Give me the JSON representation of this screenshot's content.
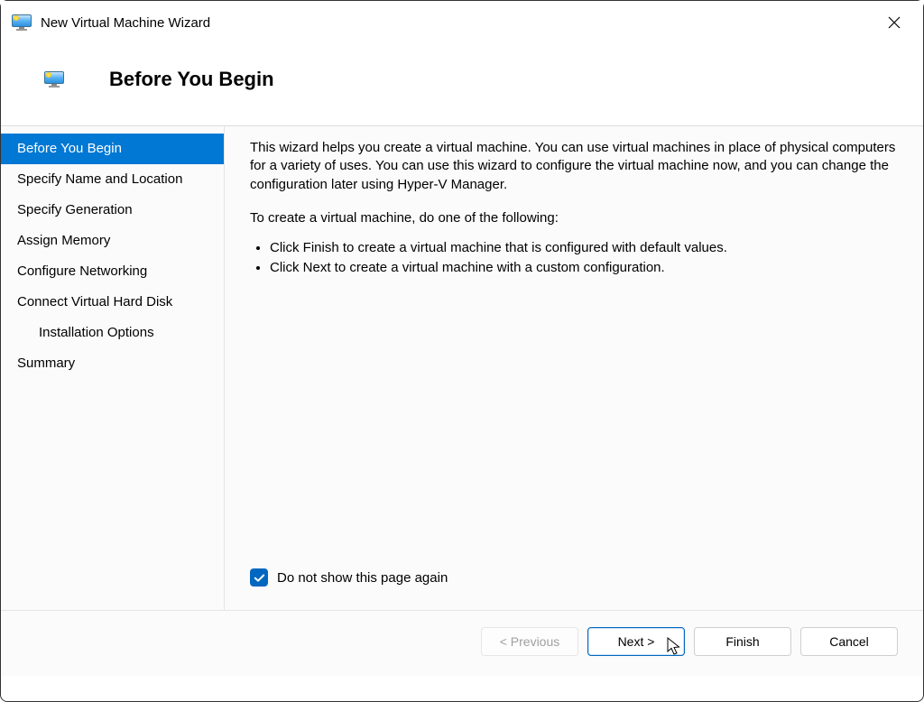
{
  "window": {
    "title": "New Virtual Machine Wizard"
  },
  "header": {
    "title": "Before You Begin"
  },
  "sidebar": {
    "items": [
      {
        "label": "Before You Begin",
        "selected": true,
        "indent": false
      },
      {
        "label": "Specify Name and Location",
        "selected": false,
        "indent": false
      },
      {
        "label": "Specify Generation",
        "selected": false,
        "indent": false
      },
      {
        "label": "Assign Memory",
        "selected": false,
        "indent": false
      },
      {
        "label": "Configure Networking",
        "selected": false,
        "indent": false
      },
      {
        "label": "Connect Virtual Hard Disk",
        "selected": false,
        "indent": false
      },
      {
        "label": "Installation Options",
        "selected": false,
        "indent": true
      },
      {
        "label": "Summary",
        "selected": false,
        "indent": false
      }
    ]
  },
  "main": {
    "intro": "This wizard helps you create a virtual machine. You can use virtual machines in place of physical computers for a variety of uses. You can use this wizard to configure the virtual machine now, and you can change the configuration later using Hyper-V Manager.",
    "instruction_lead": "To create a virtual machine, do one of the following:",
    "bullets": [
      "Click Finish to create a virtual machine that is configured with default values.",
      "Click Next to create a virtual machine with a custom configuration."
    ],
    "checkbox": {
      "checked": true,
      "label": "Do not show this page again"
    }
  },
  "buttons": {
    "previous": "< Previous",
    "next": "Next >",
    "finish": "Finish",
    "cancel": "Cancel"
  }
}
